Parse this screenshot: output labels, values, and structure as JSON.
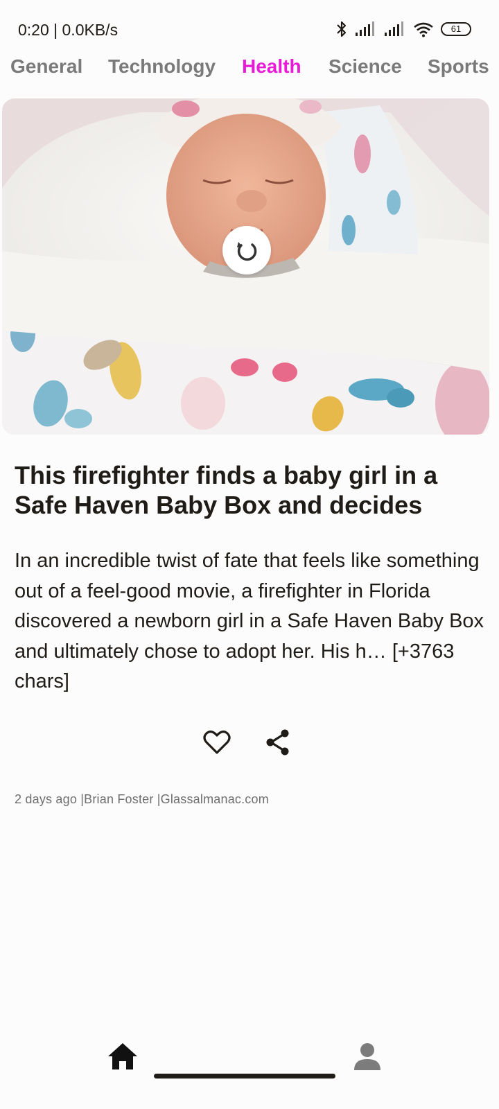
{
  "status_bar": {
    "time": "0:20 | 0.0KB/s",
    "battery": "61"
  },
  "tabs": [
    {
      "label": "General",
      "active": false
    },
    {
      "label": "Technology",
      "active": false
    },
    {
      "label": "Health",
      "active": true
    },
    {
      "label": "Science",
      "active": false
    },
    {
      "label": "Sports",
      "active": false
    }
  ],
  "article": {
    "headline": "This firefighter finds a baby girl in a Safe Haven Baby Box and decides",
    "description": "In an incredible twist of fate that feels like something out of a feel-good movie, a firefighter in Florida discovered a newborn girl in a Safe Haven Baby Box and ultimately chose to adopt her. His h… [+3763 chars]",
    "meta": "2 days ago |Brian Foster |Glassalmanac.com"
  },
  "colors": {
    "accent": "#e81cd8",
    "tab_inactive": "#7a7a7a",
    "text": "#1f1b16",
    "meta": "#6f6f6f"
  },
  "icons": {
    "refresh": "refresh-icon",
    "like": "heart-icon",
    "share": "share-icon",
    "home": "home-icon",
    "profile": "person-icon"
  }
}
